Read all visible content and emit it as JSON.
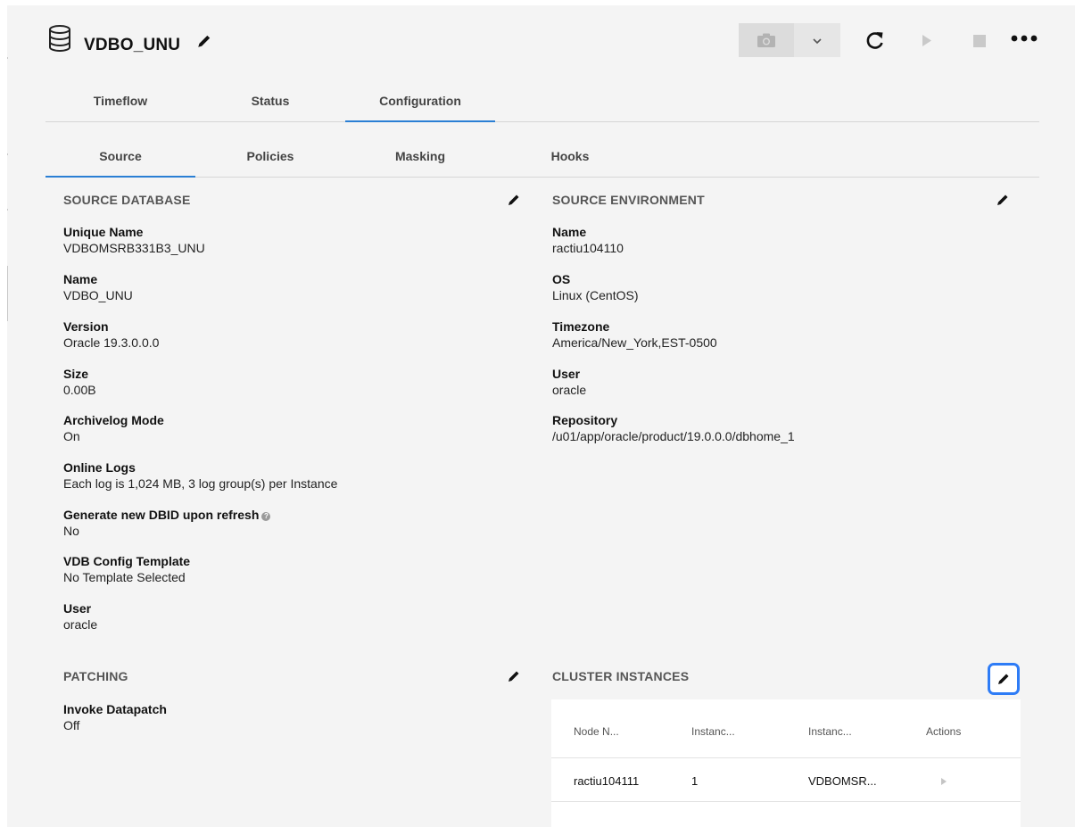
{
  "header": {
    "title": "VDBO_UNU",
    "icons": {
      "database": "database-icon",
      "edit": "pencil-icon",
      "snapshot": "camera-icon",
      "dropdown": "chevron-down-icon",
      "refresh": "refresh-icon",
      "start": "play-icon",
      "stop": "stop-icon",
      "more": "more-icon"
    }
  },
  "main_tabs": {
    "timeflow": "Timeflow",
    "status": "Status",
    "configuration": "Configuration"
  },
  "sub_tabs": {
    "source": "Source",
    "policies": "Policies",
    "masking": "Masking",
    "hooks": "Hooks"
  },
  "source_database": {
    "title": "SOURCE DATABASE",
    "unique_name_label": "Unique Name",
    "unique_name": "VDBOMSRB331B3_UNU",
    "name_label": "Name",
    "name": "VDBO_UNU",
    "version_label": "Version",
    "version": "Oracle 19.3.0.0.0",
    "size_label": "Size",
    "size": "0.00B",
    "archivelog_label": "Archivelog Mode",
    "archivelog": "On",
    "online_logs_label": "Online Logs",
    "online_logs": "Each log is 1,024 MB, 3 log group(s) per Instance",
    "dbid_label": "Generate new DBID upon refresh",
    "dbid_help": "?",
    "dbid": "No",
    "template_label": "VDB Config Template",
    "template": "No Template Selected",
    "user_label": "User",
    "user": "oracle"
  },
  "source_environment": {
    "title": "SOURCE ENVIRONMENT",
    "name_label": "Name",
    "name": "ractiu104110",
    "os_label": "OS",
    "os": "Linux (CentOS)",
    "timezone_label": "Timezone",
    "timezone": "America/New_York,EST-0500",
    "user_label": "User",
    "user": "oracle",
    "repository_label": "Repository",
    "repository": "/u01/app/oracle/product/19.0.0.0/dbhome_1"
  },
  "patching": {
    "title": "PATCHING",
    "datapatch_label": "Invoke Datapatch",
    "datapatch": "Off"
  },
  "cluster_instances": {
    "title": "CLUSTER INSTANCES",
    "columns": [
      "Node N...",
      "Instanc...",
      "Instanc...",
      "Actions"
    ],
    "rows": [
      {
        "node": "ractiu104111",
        "instance_number": "1",
        "instance_name": "VDBOMSR..."
      }
    ]
  },
  "colors": {
    "accent": "#2a7fd4",
    "highlight": "#2e7cf6",
    "page_bg": "#f4f4f4"
  }
}
